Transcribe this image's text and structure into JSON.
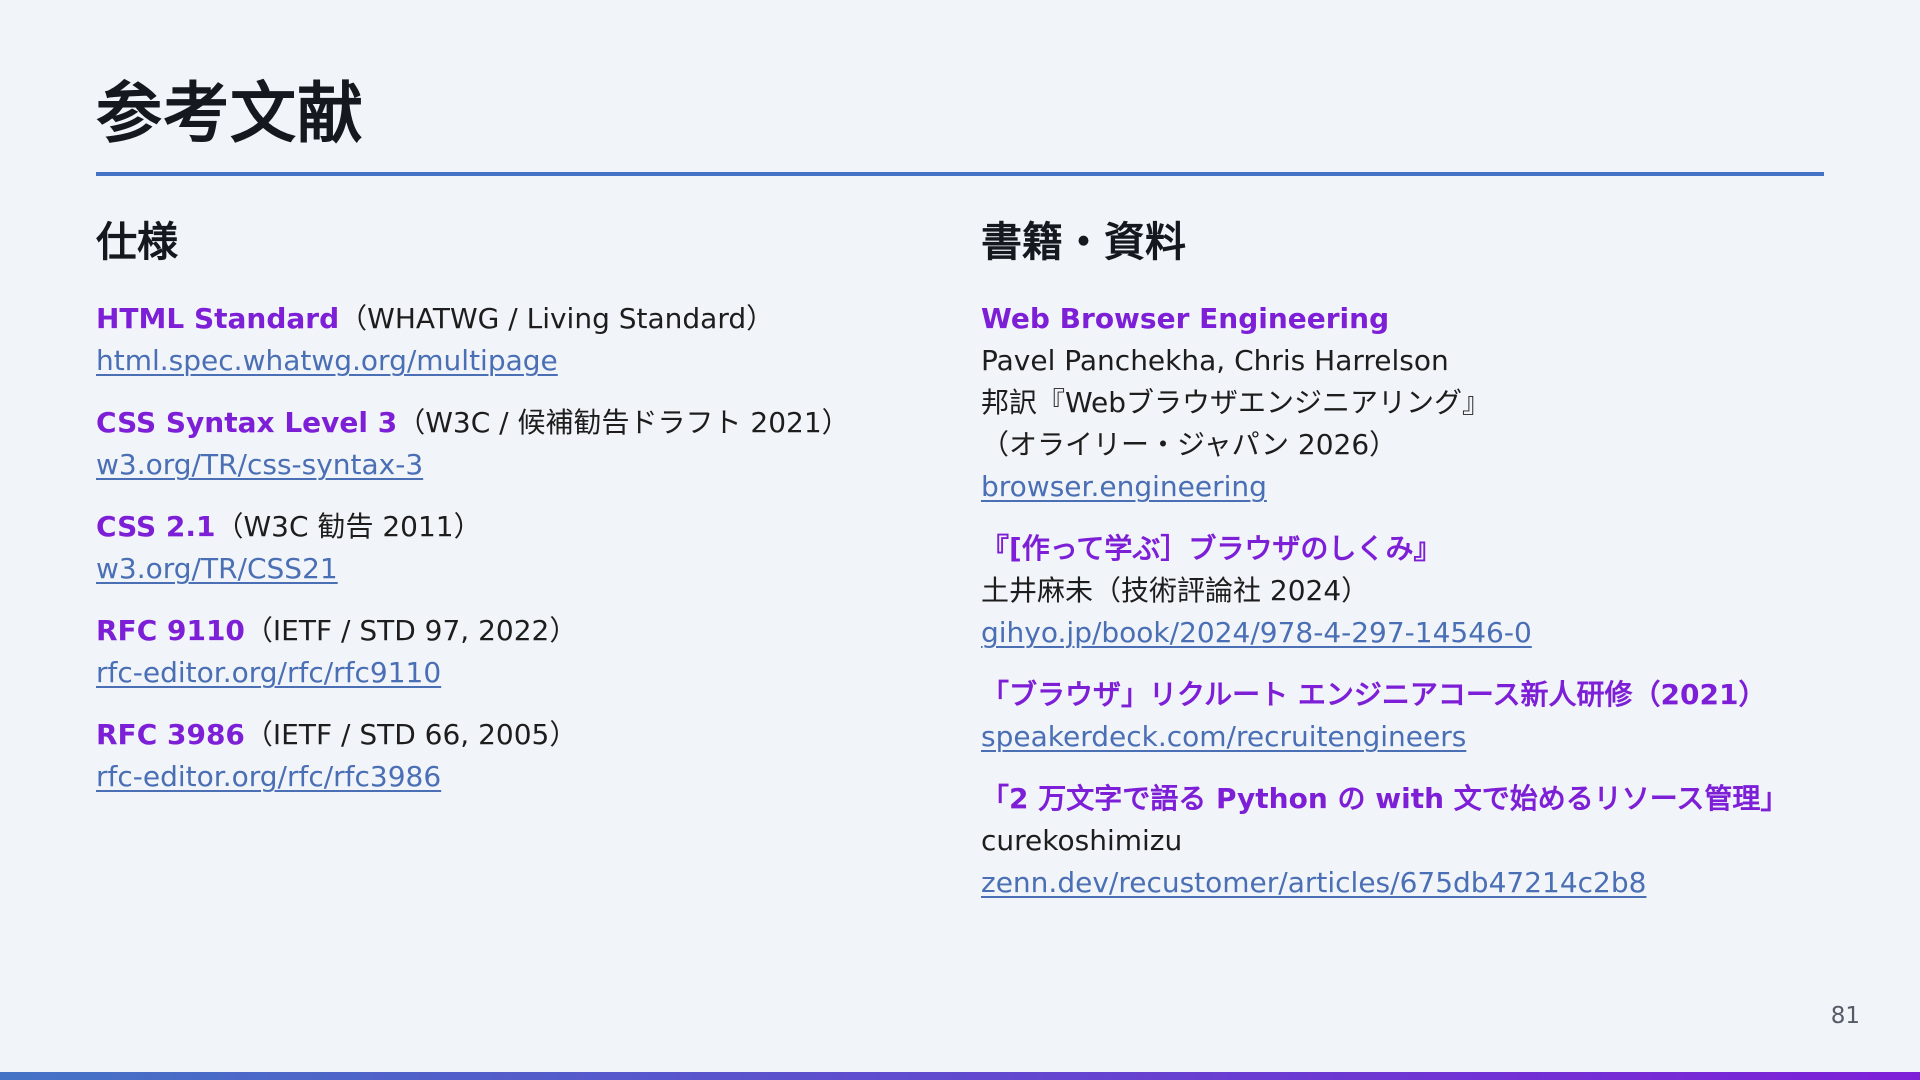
{
  "slide": {
    "title": "参考文献",
    "page_number": "81",
    "accent_color": "#4473c5",
    "title_color": "#7e1fd8",
    "link_color": "#4a6fb5"
  },
  "left": {
    "heading": "仕様",
    "refs": [
      {
        "title": "HTML Standard",
        "note": "（WHATWG / Living Standard）",
        "link": "html.spec.whatwg.org/multipage"
      },
      {
        "title": "CSS Syntax Level 3",
        "note": "（W3C / 候補勧告ドラフト 2021）",
        "link": "w3.org/TR/css-syntax-3"
      },
      {
        "title": "CSS 2.1",
        "note": "（W3C 勧告 2011）",
        "link": "w3.org/TR/CSS21"
      },
      {
        "title": "RFC 9110",
        "note": "（IETF / STD 97, 2022）",
        "link": "rfc-editor.org/rfc/rfc9110"
      },
      {
        "title": "RFC 3986",
        "note": "（IETF / STD 66, 2005）",
        "link": "rfc-editor.org/rfc/rfc3986"
      }
    ]
  },
  "right": {
    "heading": "書籍・資料",
    "refs": [
      {
        "title": "Web Browser Engineering",
        "author": "Pavel Panchekha, Chris Harrelson",
        "detail": "邦訳『Webブラウザエンジニアリング』",
        "publisher": "（オライリー・ジャパン 2026）",
        "link": "browser.engineering"
      },
      {
        "title": "『[作って学ぶ］ブラウザのしくみ』",
        "author": "土井麻未（技術評論社 2024）",
        "link": "gihyo.jp/book/2024/978-4-297-14546-0"
      },
      {
        "title": "「ブラウザ」リクルート エンジニアコース新人研修（2021）",
        "link": "speakerdeck.com/recruitengineers"
      },
      {
        "title": "「2 万文字で語る Python の with 文で始めるリソース管理」",
        "author": "curekoshimizu",
        "link": "zenn.dev/recustomer/articles/675db47214c2b8"
      }
    ]
  }
}
